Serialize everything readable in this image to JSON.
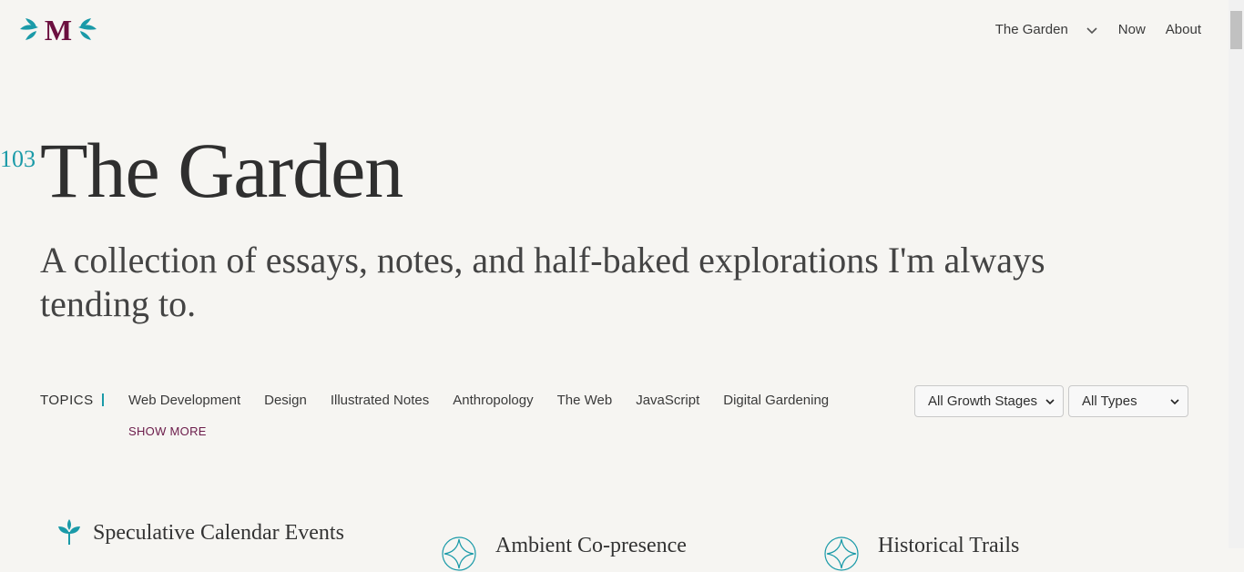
{
  "logo": {
    "letter": "M",
    "icon": "leaf-flourish-icon",
    "colors": {
      "letter": "#6b0f3f",
      "leaves": "#1a9aa8"
    }
  },
  "nav": {
    "items": [
      {
        "label": "The Garden",
        "icon": "chevron-down-icon"
      },
      {
        "label": "Now"
      },
      {
        "label": "About"
      }
    ]
  },
  "hero": {
    "count": "103",
    "title": "The Garden",
    "subtitle": "A collection of essays, notes, and half-baked explorations I'm always tending to."
  },
  "topics": {
    "label": "TOPICS",
    "items": [
      "Web Development",
      "Design",
      "Illustrated Notes",
      "Anthropology",
      "The Web",
      "JavaScript",
      "Digital Gardening"
    ],
    "show_more": "SHOW MORE"
  },
  "filters": {
    "growth": {
      "selected": "All Growth Stages"
    },
    "type": {
      "selected": "All Types"
    }
  },
  "cards": [
    {
      "title": "Speculative Calendar Events",
      "icon": "seedling-icon"
    },
    {
      "title": "Ambient Co-presence",
      "icon": "sparkle-circle-icon"
    },
    {
      "title": "Historical Trails",
      "icon": "sparkle-circle-icon"
    }
  ],
  "colors": {
    "accent": "#1a9aa8",
    "brand": "#6b0f3f",
    "background": "#f6f5f2"
  }
}
